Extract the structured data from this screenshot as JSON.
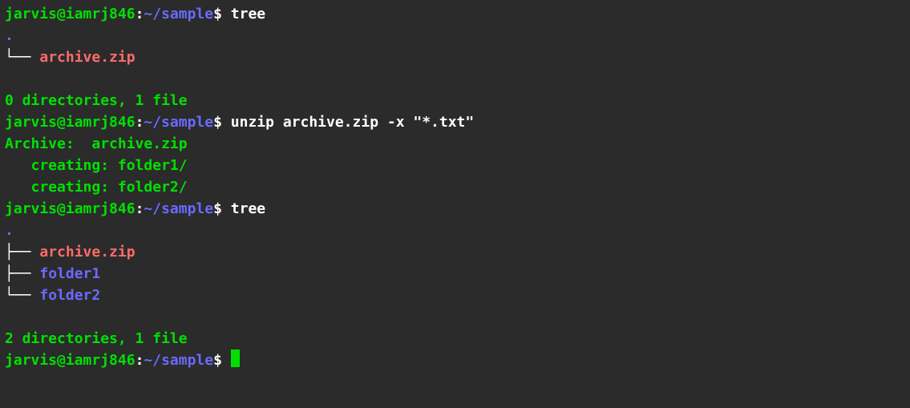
{
  "prompt": {
    "user": "jarvis@iamrj846",
    "sep": ":",
    "path": "~/sample",
    "dollar": "$"
  },
  "cmd1": "tree",
  "tree1": {
    "dot": ".",
    "branch1": "└── ",
    "file1": "archive.zip",
    "summary": "0 directories, 1 file"
  },
  "cmd2": "unzip archive.zip -x \"*.txt\"",
  "unzip": {
    "archive": "Archive:  archive.zip",
    "create1": "   creating: folder1/",
    "create2": "   creating: folder2/"
  },
  "cmd3": "tree",
  "tree2": {
    "dot": ".",
    "branch1": "├── ",
    "file1": "archive.zip",
    "branch2": "├── ",
    "dir1": "folder1",
    "branch3": "└── ",
    "dir2": "folder2",
    "summary": "2 directories, 1 file"
  }
}
